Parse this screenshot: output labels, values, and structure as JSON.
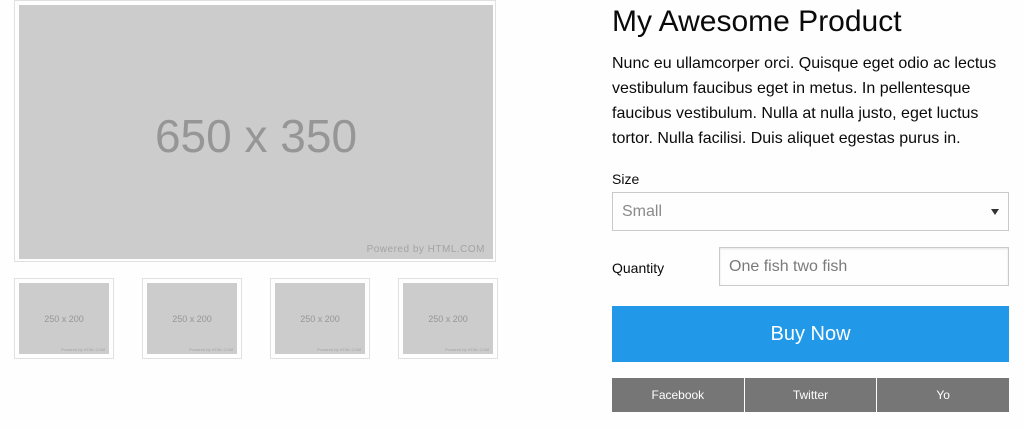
{
  "gallery": {
    "main": {
      "dimensions": "650 x 350",
      "watermark": "Powered by HTML.COM"
    },
    "thumbnails": [
      {
        "dimensions": "250 x 200",
        "watermark": "Powered by HTML.COM"
      },
      {
        "dimensions": "250 x 200",
        "watermark": "Powered by HTML.COM"
      },
      {
        "dimensions": "250 x 200",
        "watermark": "Powered by HTML.COM"
      },
      {
        "dimensions": "250 x 200",
        "watermark": "Powered by HTML.COM"
      }
    ]
  },
  "product": {
    "title": "My Awesome Product",
    "description": "Nunc eu ullamcorper orci. Quisque eget odio ac lectus vestibulum faucibus eget in metus. In pellentesque faucibus vestibulum. Nulla at nulla justo, eget luctus tortor. Nulla facilisi. Duis aliquet egestas purus in."
  },
  "form": {
    "size_label": "Size",
    "size_selected": "Small",
    "quantity_label": "Quantity",
    "quantity_placeholder": "One fish two fish"
  },
  "actions": {
    "buy_label": "Buy Now",
    "share": [
      "Facebook",
      "Twitter",
      "Yo"
    ]
  },
  "colors": {
    "primary": "#2199e8",
    "share_button": "#767676",
    "placeholder_bg": "#cccccc"
  }
}
